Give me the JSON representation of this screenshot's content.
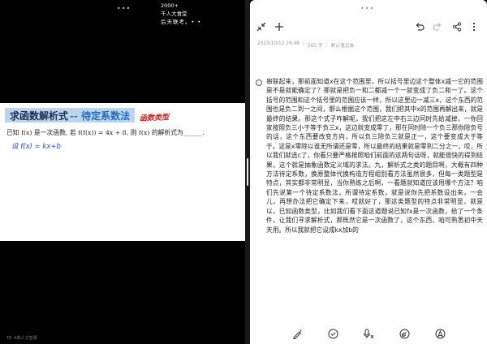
{
  "left_pane": {
    "top_dots": "•••",
    "overlay": {
      "line1": "2000+",
      "line2": "千人大食堂",
      "line3": "后天联考。• •"
    },
    "slide": {
      "title_main": "求函数解析式",
      "title_sub": "-- 待定系数法",
      "red_note": "函数类型",
      "problem": "已知 f(x) 是一次函数, 若 f(f(x)) = 4x + 8, 则 f(x) 的解析式为______.",
      "handwriting": "设 f(x) = kx+b"
    },
    "footer": "T8 ·K和人文智惠"
  },
  "right_pane": {
    "top_dots": "•••",
    "toolbar": {
      "collapse_icon": "collapse-diagonal-icon",
      "add_icon": "plus-icon",
      "undo_icon": "undo-icon",
      "redo_icon": "redo-icon",
      "share_icon": "share-icon",
      "more_icon": "more-vertical-icon"
    },
    "meta": {
      "datetime": "2025/10/12 16:48",
      "chars": "563 字",
      "notebook": "默认笔记本"
    },
    "note_text": "串联起来，那前面知道x在这个范围里，所以括号里边这个整体x减一它的范围是不是就能确定了？那就是把负一和二都减一个一就变成了负二和一了。这个括号的范围和这个括号里的范围应该一样，所以这里边一减三x，这个东西的范围也是负二到一之间，那么根据这个范围，我们把其中x的范围再解出来，就是最终的结果。那这个式子咋解呢，我们把这左中右三边同时先给减掉，一你回家按照负三小于等于负三x，这边就变成零了，那在同时除一个负三那你除负号的话，这个东西要改变方向，所以负三除负三就是正一，这个要变成大于等于。这是x零除以谁无所谓还是零，所以最终的结果就是零到二分之一，哎，所以我们就选c了，你看只要严格按照咱们前面的这两句话呀，就能很快的得到结果，这个就是抽象函数定义域的求法。九，解析式之类的题目啊，大概有四种方法待定系数，换原整体代换构造方程组别看方法虽然很多，但每一类题型是特点，其实都非常明显，当你熟练之后啊，一看题就知道应该用哪个方法？咱们先说第一个待定系数法，所谓待定系数，就是说你先把系数设出来，一会儿，再想办法把它确定下来，哎就好了，那这类题型的特点非常明显，就是以，已知函数类型，比如我们看下面这道题说已知fx是一次函数，给了一个条件，让我们寻求解析式，那既然它是一次函数了，这个东西，咱可熟悉初中天天用。所以我就把它设成kx加b的",
    "bottom_bar": {
      "pen_icon": "pen-sparkle-icon",
      "check_icon": "check-circle-icon",
      "mic_icon": "microphone-icon",
      "link_icon": "link-circle-icon",
      "compass_icon": "compass-circle-icon"
    }
  },
  "colors": {
    "accent_blue": "#1f6cc4",
    "title_bar_bg": "#bcd5ea",
    "red_note": "#d31b1b",
    "handwriting": "#1d4fc9"
  }
}
